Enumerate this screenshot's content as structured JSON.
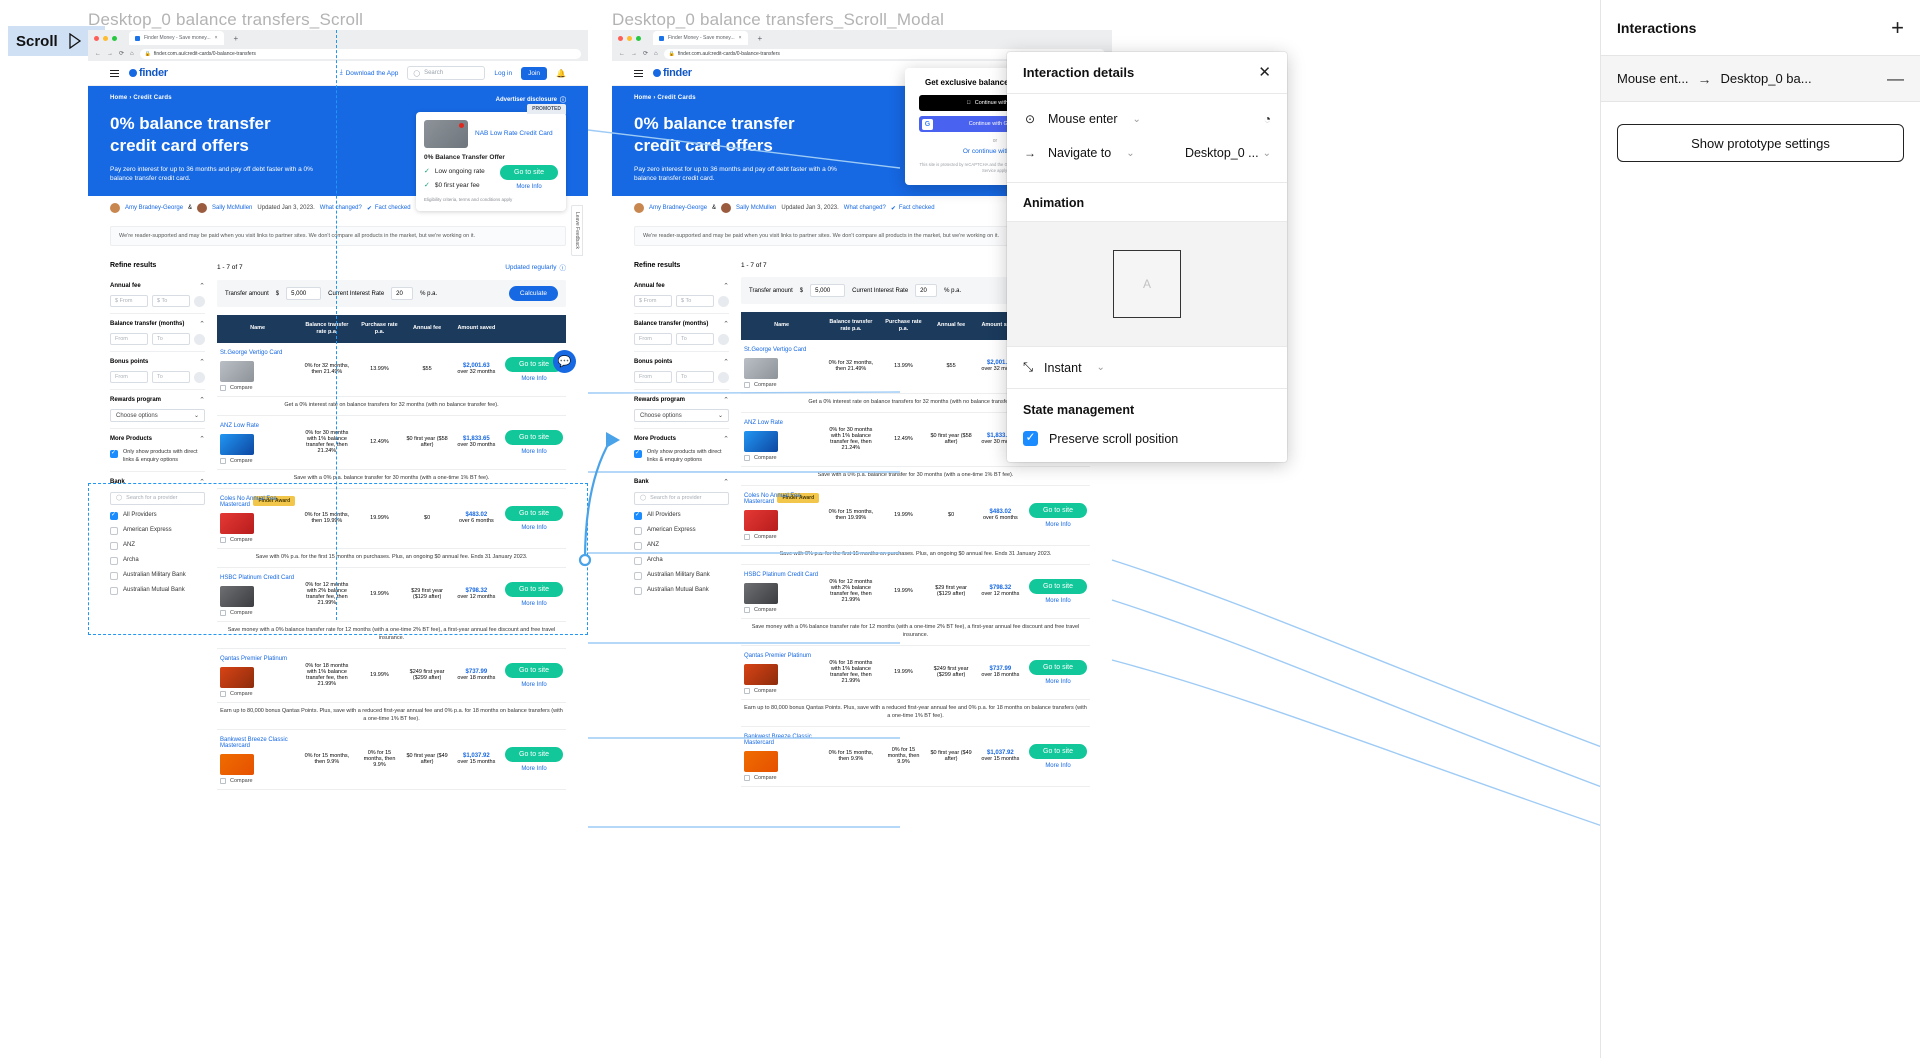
{
  "canvas": {
    "scroll_badge": {
      "label": "Scroll",
      "icon": "play-icon"
    },
    "frames": [
      {
        "title": "Desktop_0 balance transfers_Scroll"
      },
      {
        "title": "Desktop_0 balance transfers_Scroll_Modal"
      }
    ]
  },
  "browser": {
    "tab_title": "Finder Money - Save money...",
    "url": "finder.com.au/credit-cards/0-balance-transfers",
    "new_tab": "+",
    "back_icon": "arrow-left-icon",
    "forward_icon": "arrow-right-icon",
    "reload_icon": "reload-icon",
    "home_icon": "home-icon",
    "lock_icon": "lock-icon"
  },
  "site": {
    "brand": "finder",
    "menu_icon": "hamburger-icon",
    "download_app": "Download the App",
    "download_icon": "download-icon",
    "search_placeholder": "Search",
    "search_icon": "search-icon",
    "login": "Log in",
    "join": "Join",
    "bell_icon": "bell-icon",
    "breadcrumb": "Home › Credit Cards",
    "advertiser_disclosure": "Advertiser disclosure",
    "hero_title_line1": "0% balance transfer",
    "hero_title_line2": "credit card offers",
    "hero_sub": "Pay zero interest for up to 36 months and pay off debt faster with a 0% balance transfer credit card.",
    "promo": {
      "tag": "PROMOTED",
      "card_name": "NAB Low Rate Credit Card",
      "offer": "0% Balance Transfer Offer",
      "features": [
        "Low ongoing rate",
        "$0 first year fee"
      ],
      "cta": "Go to site",
      "more_info": "More Info",
      "fine_print": "Eligibility criteria, terms and conditions apply"
    },
    "byline": {
      "author1": "Amy Bradney-George",
      "amp": "&",
      "author2": "Sally McMullen",
      "updated": "Updated Jan 3, 2023.",
      "what_changed": "What changed?",
      "fact_checked": "Fact checked",
      "fact_icon": "shield-check-icon"
    },
    "notice": "We're reader-supported and may be paid when you visit links to partner sites. We don't compare all products in the market, but we're working on it.",
    "feedback_tab": "Leave Feedback",
    "chat_icon": "chat-bubble-icon"
  },
  "refine": {
    "title": "Refine results",
    "groups": [
      {
        "label": "Annual fee",
        "type": "range",
        "from": "$ From",
        "to": "$ To"
      },
      {
        "label": "Balance transfer (months)",
        "type": "range",
        "from": "From",
        "to": "To"
      },
      {
        "label": "Bonus points",
        "type": "range",
        "from": "From",
        "to": "To"
      },
      {
        "label": "Rewards program",
        "type": "select",
        "value": "Choose options"
      }
    ],
    "more_products": {
      "label": "More Products",
      "checkbox_label": "Only show products with direct links & enquiry options",
      "checked": true
    },
    "bank": {
      "label": "Bank",
      "search_placeholder": "Search for a provider",
      "providers": [
        {
          "name": "All Providers",
          "checked": true
        },
        {
          "name": "American Express",
          "checked": false
        },
        {
          "name": "ANZ",
          "checked": false
        },
        {
          "name": "Archa",
          "checked": false
        },
        {
          "name": "Australian Military Bank",
          "checked": false
        },
        {
          "name": "Australian Mutual Bank",
          "checked": false
        }
      ]
    }
  },
  "results": {
    "count_label": "1 - 7 of 7",
    "updated_regularly": "Updated regularly",
    "calculator": {
      "transfer_amount_label": "Transfer amount",
      "currency": "$",
      "transfer_amount_value": "5,000",
      "interest_rate_label": "Current Interest Rate",
      "interest_rate_value": "20",
      "interest_unit": "% p.a.",
      "button": "Calculate"
    },
    "columns": [
      "Name",
      "Balance transfer rate p.a.",
      "Purchase rate p.a.",
      "Annual fee",
      "Amount saved"
    ],
    "rows": [
      {
        "name": "St.George Vertigo Card",
        "bt_rate": "0% for 32 months, then 21.49%",
        "purchase_rate": "13.99%",
        "annual_fee": "$55",
        "amount_saved": "$2,001.63",
        "saved_period": "over 32 months",
        "cta": "Go to site",
        "more_info": "More Info",
        "compare": "Compare",
        "blurb": "Get a 0% interest rate on balance transfers for 32 months (with no balance transfer fee).",
        "award": ""
      },
      {
        "name": "ANZ Low Rate",
        "bt_rate": "0% for 30 months with 1% balance transfer fee, then 21.24%",
        "purchase_rate": "12.49%",
        "annual_fee": "$0 first year ($58 after)",
        "amount_saved": "$1,833.65",
        "saved_period": "over 30 months",
        "cta": "Go to site",
        "more_info": "More Info",
        "compare": "Compare",
        "blurb": "Save with a 0% p.a. balance transfer for 30 months (with a one-time 1% BT fee).",
        "award": ""
      },
      {
        "name": "Coles No Annual Fee Mastercard",
        "bt_rate": "0% for 15 months, then 19.99%",
        "purchase_rate": "19.99%",
        "annual_fee": "$0",
        "amount_saved": "$483.02",
        "saved_period": "over 6 months",
        "cta": "Go to site",
        "more_info": "More Info",
        "compare": "Compare",
        "blurb": "Save with 0% p.a. for the first 15 months on purchases. Plus, an ongoing $0 annual fee. Ends 31 January 2023.",
        "award": "Finder Award"
      },
      {
        "name": "HSBC Platinum Credit Card",
        "bt_rate": "0% for 12 months with 2% balance transfer fee, then 21.99%",
        "purchase_rate": "19.99%",
        "annual_fee": "$29 first year ($129 after)",
        "amount_saved": "$798.32",
        "saved_period": "over 12 months",
        "cta": "Go to site",
        "more_info": "More Info",
        "compare": "Compare",
        "blurb": "Save money with a 0% balance transfer rate for 12 months (with a one-time 2% BT fee), a first-year annual fee discount and free travel insurance.",
        "award": ""
      },
      {
        "name": "Qantas Premier Platinum",
        "bt_rate": "0% for 18 months with 1% balance transfer fee, then 21.99%",
        "purchase_rate": "19.99%",
        "annual_fee": "$249 first year ($299 after)",
        "amount_saved": "$737.99",
        "saved_period": "over 18 months",
        "cta": "Go to site",
        "more_info": "More Info",
        "compare": "Compare",
        "blurb": "Earn up to 80,000 bonus Qantas Points. Plus, save with a reduced first-year annual fee and 0% p.a. for 18 months on balance transfers (with a one-time 1% BT fee).",
        "award": ""
      },
      {
        "name": "Bankwest Breeze Classic Mastercard",
        "bt_rate": "0% for 15 months, then 9.9%",
        "purchase_rate": "0% for 15 months, then 9.9%",
        "annual_fee": "$0 first year ($49 after)",
        "amount_saved": "$1,037.92",
        "saved_period": "over 15 months",
        "cta": "Go to site",
        "more_info": "More Info",
        "compare": "Compare",
        "blurb": "",
        "award": ""
      }
    ]
  },
  "modal": {
    "title": "Get exclusive balance transfer offers",
    "apple": "Continue with Apple",
    "google": "Continue with Google",
    "or": "or",
    "email_prefix": "Or continue with",
    "email_link": "email",
    "fine_print": "This site is protected by reCAPTCHA and the Google Privacy Policy and Terms of Service apply."
  },
  "right_panel": {
    "title": "Interactions",
    "add_icon": "plus-icon",
    "interaction_row": {
      "trigger": "Mouse ent...",
      "arrow_icon": "arrow-right-icon",
      "destination": "Desktop_0 ba...",
      "collapse_icon": "minus-icon"
    },
    "show_prototype_settings": "Show prototype settings"
  },
  "interaction_details": {
    "title": "Interaction details",
    "close_icon": "close-icon",
    "trigger": {
      "icon": "mouse-enter-icon",
      "label": "Mouse enter",
      "chevron": "chevron-down-icon",
      "timer_icon": "timer-icon"
    },
    "action": {
      "icon": "navigate-arrow-icon",
      "label": "Navigate to",
      "chevron": "chevron-down-icon",
      "destination": "Desktop_0 ...",
      "destination_chevron": "chevron-down-icon"
    },
    "animation": {
      "heading": "Animation",
      "preview_letter": "A",
      "easing_icon": "instant-icon",
      "easing": "Instant",
      "easing_chevron": "chevron-down-icon"
    },
    "state_management": {
      "heading": "State management",
      "preserve_scroll_label": "Preserve scroll position",
      "preserve_scroll_checked": true
    }
  },
  "colors": {
    "figma_blue": "#1a8cff",
    "brand_blue": "#1668e3",
    "cta_green": "#12c79a",
    "table_header": "#1b3a5c",
    "selection_dash": "#2196f3",
    "badge_bg": "#cfe0f5"
  }
}
